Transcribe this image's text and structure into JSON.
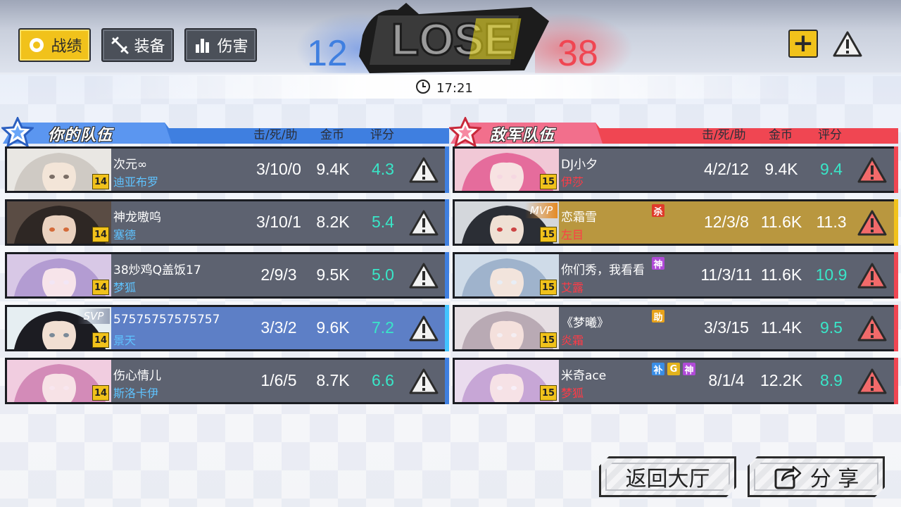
{
  "toolbar": {
    "tabs": [
      {
        "label": "战绩",
        "icon": "ring-icon",
        "active": true
      },
      {
        "label": "装备",
        "icon": "sword-icon",
        "active": false
      },
      {
        "label": "伤害",
        "icon": "bar-chart-icon",
        "active": false
      }
    ]
  },
  "result": {
    "our_score": "12",
    "enemy_score": "38",
    "outcome": "LOSE",
    "time": "17:21"
  },
  "colors": {
    "our_team": "#3f7fe0",
    "enemy_team": "#f04652",
    "rating": "#39e6c8",
    "hero_blue": "#5ec3ff",
    "hero_red": "#ff3b46",
    "level_badge": "#f1c21b"
  },
  "headers": {
    "our_team_title": "你的队伍",
    "enemy_team_title": "敌军队伍",
    "kda": "击/死/助",
    "gold": "金币",
    "rating": "评分"
  },
  "our_team": [
    {
      "player": "次元∞",
      "hero": "迪亚布罗",
      "level": "14",
      "kda": "3/10/0",
      "gold": "9.4K",
      "rating": "4.3",
      "tag": ""
    },
    {
      "player": "神龙嗷呜",
      "hero": "塞德",
      "level": "14",
      "kda": "3/10/1",
      "gold": "8.2K",
      "rating": "5.4",
      "tag": ""
    },
    {
      "player": "38炒鸡Q盖饭17",
      "hero": "梦狐",
      "level": "14",
      "kda": "2/9/3",
      "gold": "9.5K",
      "rating": "5.0",
      "tag": ""
    },
    {
      "player": "57575757575757",
      "hero": "景天",
      "level": "14",
      "kda": "3/3/2",
      "gold": "9.6K",
      "rating": "7.2",
      "tag": "SVP"
    },
    {
      "player": "伤心情儿",
      "hero": "斯洛卡伊",
      "level": "14",
      "kda": "1/6/5",
      "gold": "8.7K",
      "rating": "6.6",
      "tag": ""
    }
  ],
  "enemy_team": [
    {
      "player": "DJ小夕",
      "hero": "伊莎",
      "level": "15",
      "kda": "4/2/12",
      "gold": "9.4K",
      "rating": "9.4",
      "tag": "",
      "badges": []
    },
    {
      "player": "恋霜雪",
      "hero": "左目",
      "level": "15",
      "kda": "12/3/8",
      "gold": "11.6K",
      "rating": "11.3",
      "tag": "MVP",
      "badges": [
        {
          "text": "杀",
          "color": "#e03a2a"
        }
      ]
    },
    {
      "player": "你们秀，我看看",
      "hero": "艾露",
      "level": "15",
      "kda": "11/3/11",
      "gold": "11.6K",
      "rating": "10.9",
      "tag": "",
      "badges": [
        {
          "text": "神",
          "color": "#b04ad8"
        }
      ]
    },
    {
      "player": "《梦曦》",
      "hero": "炎霜",
      "level": "15",
      "kda": "3/3/15",
      "gold": "11.4K",
      "rating": "9.5",
      "tag": "",
      "badges": [
        {
          "text": "助",
          "color": "#e8a21a"
        }
      ]
    },
    {
      "player": "米奇ace",
      "hero": "梦狐",
      "level": "15",
      "kda": "8/1/4",
      "gold": "12.2K",
      "rating": "8.9",
      "tag": "",
      "badges": [
        {
          "text": "补",
          "color": "#3a8ee6"
        },
        {
          "text": "G",
          "color": "#e2b21c"
        },
        {
          "text": "神",
          "color": "#b04ad8"
        }
      ]
    }
  ],
  "buttons": {
    "return_lobby": "返回大厅",
    "share": "分 享"
  }
}
